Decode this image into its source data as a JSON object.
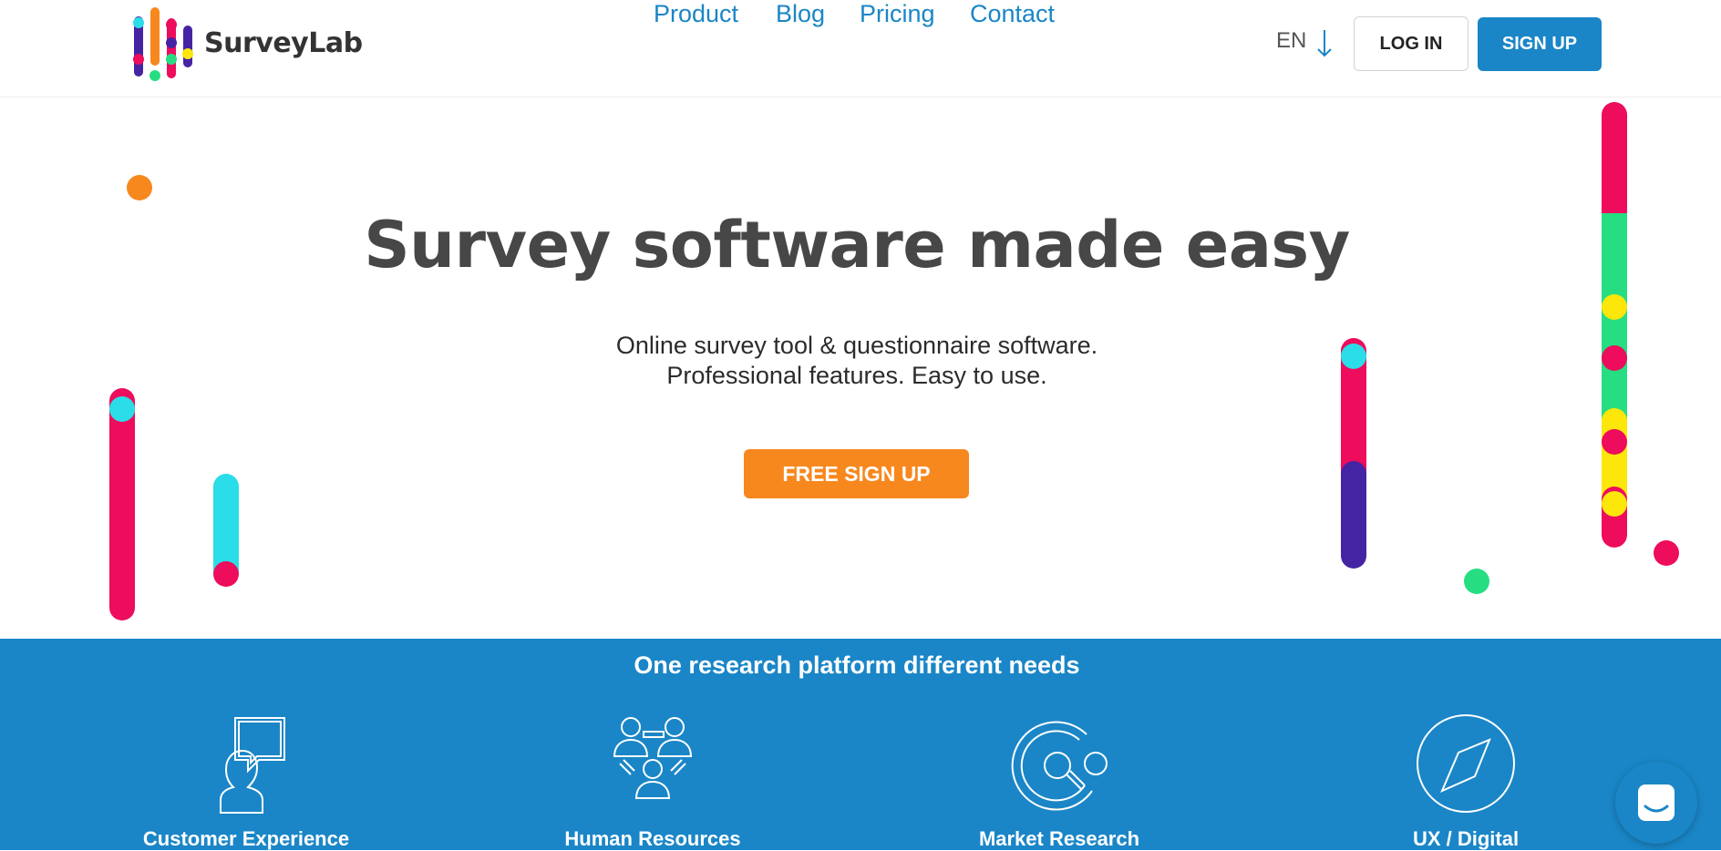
{
  "brand": {
    "name": "SurveyLab"
  },
  "nav": {
    "links": [
      "Product",
      "Blog",
      "Pricing",
      "Contact"
    ]
  },
  "header": {
    "language": "EN",
    "login_label": "LOG IN",
    "signup_label": "SIGN UP"
  },
  "hero": {
    "title": "Survey software made easy",
    "subtitle_line1": "Online survey tool & questionnaire software.",
    "subtitle_line2": "Professional features. Easy to use.",
    "cta_label": "FREE SIGN UP"
  },
  "platform": {
    "title": "One research platform different needs",
    "needs": [
      {
        "label": "Customer Experience",
        "icon": "customer-experience-icon"
      },
      {
        "label": "Human Resources",
        "icon": "human-resources-icon"
      },
      {
        "label": "Market Research",
        "icon": "market-research-icon"
      },
      {
        "label": "UX / Digital",
        "icon": "ux-digital-icon"
      }
    ]
  },
  "chat": {
    "icon": "chat-icon"
  },
  "colors": {
    "accent_blue": "#1a86c7",
    "cta_orange": "#f7881e",
    "pink": "#ee0c5c",
    "cyan": "#2adde8",
    "green": "#26de81",
    "yellow": "#fde60a",
    "purple": "#4524a3"
  }
}
